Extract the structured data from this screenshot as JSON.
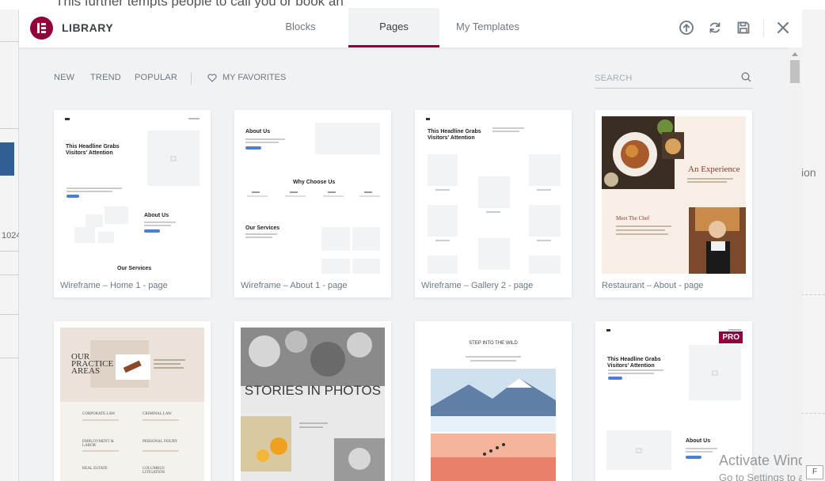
{
  "background": {
    "top_text": "This further tempts people to call you or book an",
    "left_number": "1024",
    "right_fragment": "ion",
    "right_label": "F"
  },
  "header": {
    "logo_letter": "E",
    "title": "LIBRARY",
    "tabs": [
      {
        "label": "Blocks",
        "active": false
      },
      {
        "label": "Pages",
        "active": true
      },
      {
        "label": "My Templates",
        "active": false
      }
    ],
    "icons": [
      "upload-icon",
      "sync-icon",
      "save-icon",
      "close-icon"
    ]
  },
  "toolbar": {
    "filters": [
      "NEW",
      "TREND",
      "POPULAR"
    ],
    "favorites_label": "MY FAVORITES",
    "search_placeholder": "SEARCH"
  },
  "cards": [
    {
      "name": "Wireframe – Home 1 - page",
      "pro": false
    },
    {
      "name": "Wireframe – About 1 - page",
      "pro": false
    },
    {
      "name": "Wireframe – Gallery 2 - page",
      "pro": false
    },
    {
      "name": "Restaurant – About - page",
      "pro": false
    },
    {
      "name": "",
      "pro": false
    },
    {
      "name": "",
      "pro": false
    },
    {
      "name": "",
      "pro": false
    },
    {
      "name": "",
      "pro": true
    }
  ],
  "pro_label": "PRO",
  "thumbs": {
    "w1": {
      "heading": "This Headline Grabs Visitors' Attention",
      "about": "About Us",
      "services": "Our Services"
    },
    "w2": {
      "about": "About Us",
      "why": "Why Choose Us",
      "services": "Our Services"
    },
    "w3": {
      "heading": "This Headline Grabs Visitors' Attention"
    },
    "rest": {
      "experience": "An Experience",
      "chef": "Meet The Chef"
    },
    "law": {
      "title": "OUR PRACTICE AREAS",
      "items": [
        "CORPORATE LAW",
        "CRIMINAL LAW",
        "EMPLOYMENT & LABOR",
        "PERSONAL INJURY",
        "REAL ESTATE",
        "COLUMBUS LITIGATION"
      ]
    },
    "photos": {
      "title": "STORIES IN PHOTOS"
    },
    "wild": {
      "title": "STEP INTO THE WILD"
    },
    "w4": {
      "heading": "This Headline Grabs Visitors' Attention",
      "about": "About Us"
    }
  },
  "watermark": {
    "title": "Activate Windo",
    "subtitle": "Go to Settings to a"
  },
  "colors": {
    "brand": "#92003b",
    "accent_blue": "#4a7fd1",
    "text": "#6d7882"
  }
}
